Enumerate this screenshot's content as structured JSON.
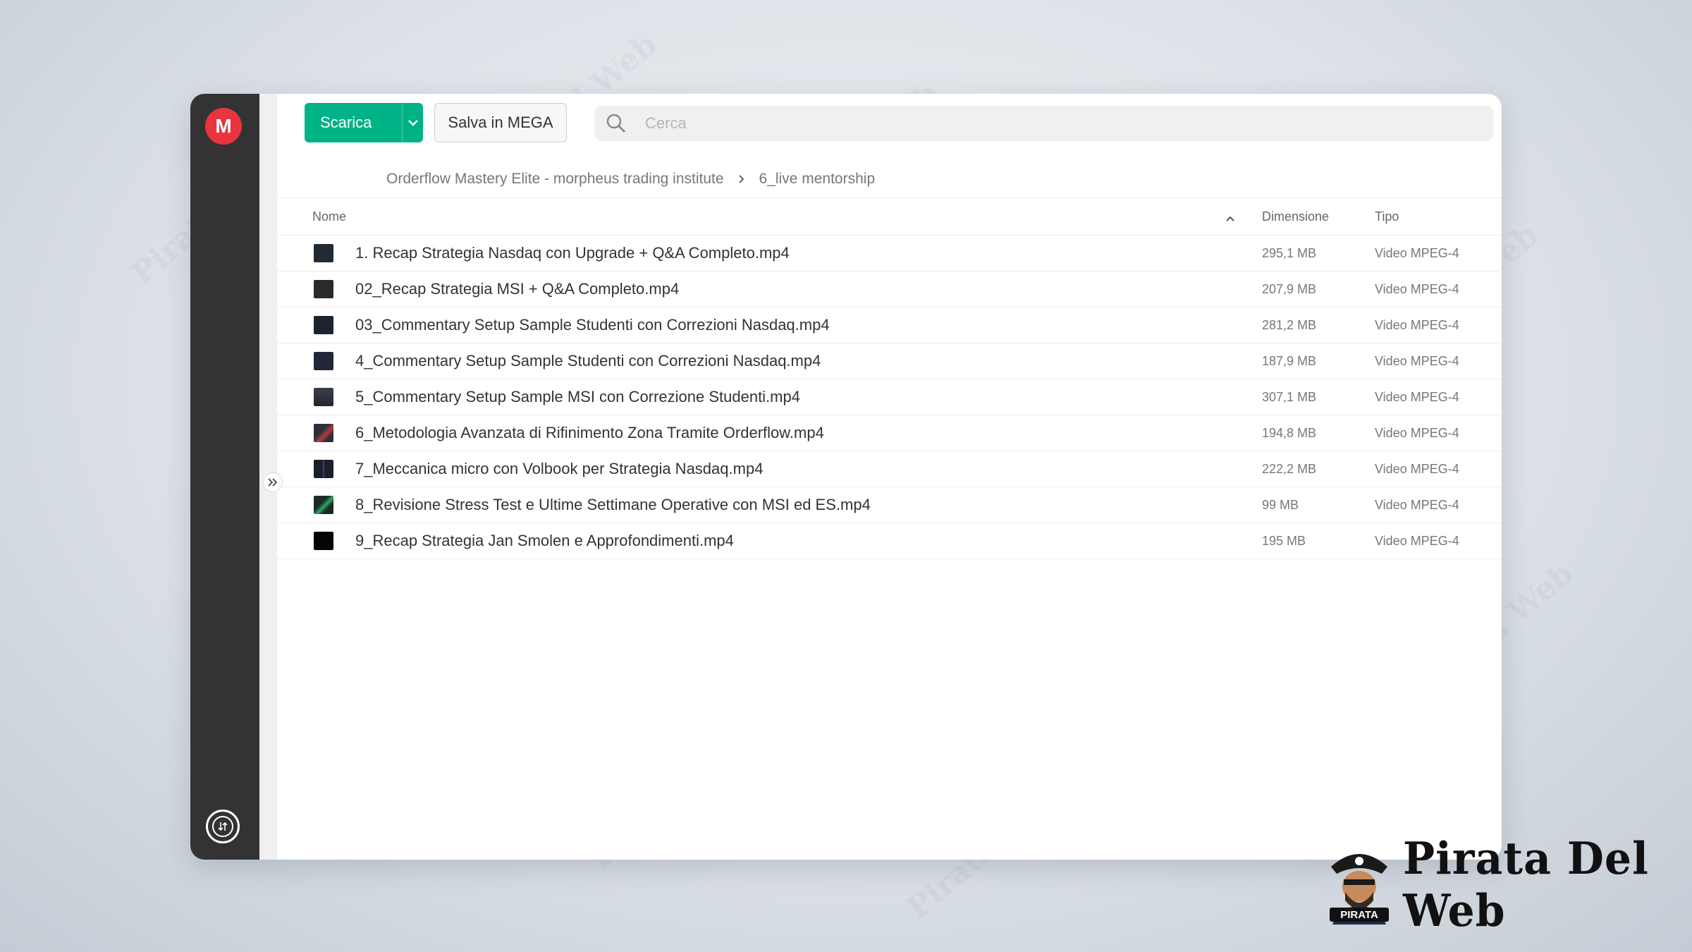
{
  "sidebar": {
    "logo": "M",
    "logo_icon": "mega-logo-icon",
    "transfer_icon": "transfer-manager-icon"
  },
  "toolbar": {
    "download_label": "Scarica",
    "save_label": "Salva in MEGA",
    "search_placeholder": "Cerca"
  },
  "breadcrumb": [
    "Orderflow Mastery Elite - morpheus trading institute",
    "6_live mentorship"
  ],
  "table": {
    "headers": {
      "name": "Nome",
      "size": "Dimensione",
      "type": "Tipo"
    },
    "sort": "ascending",
    "rows": [
      {
        "name": "1. Recap Strategia Nasdaq con Upgrade + Q&A Completo.mp4",
        "size": "295,1 MB",
        "type": "Video MPEG-4"
      },
      {
        "name": "02_Recap Strategia MSI + Q&A Completo.mp4",
        "size": "207,9 MB",
        "type": "Video MPEG-4"
      },
      {
        "name": "03_Commentary Setup Sample Studenti con Correzioni Nasdaq.mp4",
        "size": "281,2 MB",
        "type": "Video MPEG-4"
      },
      {
        "name": "4_Commentary Setup Sample Studenti con Correzioni Nasdaq.mp4",
        "size": "187,9 MB",
        "type": "Video MPEG-4"
      },
      {
        "name": "5_Commentary Setup Sample MSI con Correzione Studenti.mp4",
        "size": "307,1 MB",
        "type": "Video MPEG-4"
      },
      {
        "name": "6_Metodologia Avanzata di Rifinimento Zona Tramite Orderflow.mp4",
        "size": "194,8 MB",
        "type": "Video MPEG-4"
      },
      {
        "name": "7_Meccanica micro con Volbook per Strategia Nasdaq.mp4",
        "size": "222,2 MB",
        "type": "Video MPEG-4"
      },
      {
        "name": "8_Revisione Stress Test e Ultime Settimane Operative con MSI ed ES.mp4",
        "size": "99 MB",
        "type": "Video MPEG-4"
      },
      {
        "name": "9_Recap Strategia Jan Smolen e Approfondimenti.mp4",
        "size": "195 MB",
        "type": "Video MPEG-4"
      }
    ]
  },
  "watermark": "Pirata Del Web",
  "brand": {
    "name": "Pirata Del Web",
    "badge_text": "PIRATA"
  },
  "colors": {
    "accent": "#00b386",
    "mega_red": "#e9343f",
    "sidebar": "#333333"
  }
}
